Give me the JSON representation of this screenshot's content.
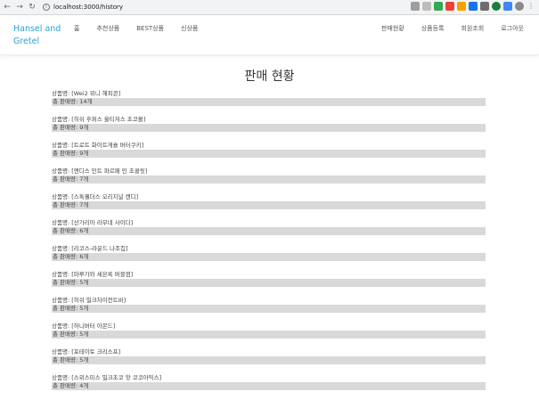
{
  "browser": {
    "url": "localhost:3000/history"
  },
  "site": {
    "brand": "Hansel and Gretel",
    "nav_left": [
      "홈",
      "추천상품",
      "BEST상품",
      "신상품"
    ],
    "nav_right": [
      "판매현황",
      "상품등록",
      "회원조회",
      "로그아웃"
    ]
  },
  "page": {
    "title": "판매 현황"
  },
  "sales": [
    {
      "name": "상품명: [Wei2 위니 해피콘]",
      "sold": "총 판매량: 14개"
    },
    {
      "name": "상품명: [히쉬 후퍼스 울티저스 초코볼]",
      "sold": "총 판매량: 9개"
    },
    {
      "name": "상품명: [트로트 화이트게숄 버터쿠키]",
      "sold": "총 판매량: 9개"
    },
    {
      "name": "상품명: [앤디스 민트 파르페 민 초콜릿]",
      "sold": "총 판매량: 7개"
    },
    {
      "name": "상품명: [스톡웰더스 오리지널 캔디]",
      "sold": "총 판매량: 7개"
    },
    {
      "name": "상품명: [산가리아 라무네 사이다]",
      "sold": "총 판매량: 6개"
    },
    {
      "name": "상품명: [리코스-라운드 나조칩]",
      "sold": "총 판매량: 6개"
    },
    {
      "name": "상품명: [마루가와 세븐록 버블껌]",
      "sold": "총 판매량: 5개"
    },
    {
      "name": "상품명: [히쉬 밀크차이컨트바]",
      "sold": "총 판매량: 5개"
    },
    {
      "name": "상품명: [허니버터 아몬드]",
      "sold": "총 판매량: 5개"
    },
    {
      "name": "상품명: [포테이토 크리스프]",
      "sold": "총 판매량: 5개"
    },
    {
      "name": "상품명: [스위스미스 밀크초코 핫 코코아믹스]",
      "sold": "총 판매량: 4개"
    }
  ]
}
